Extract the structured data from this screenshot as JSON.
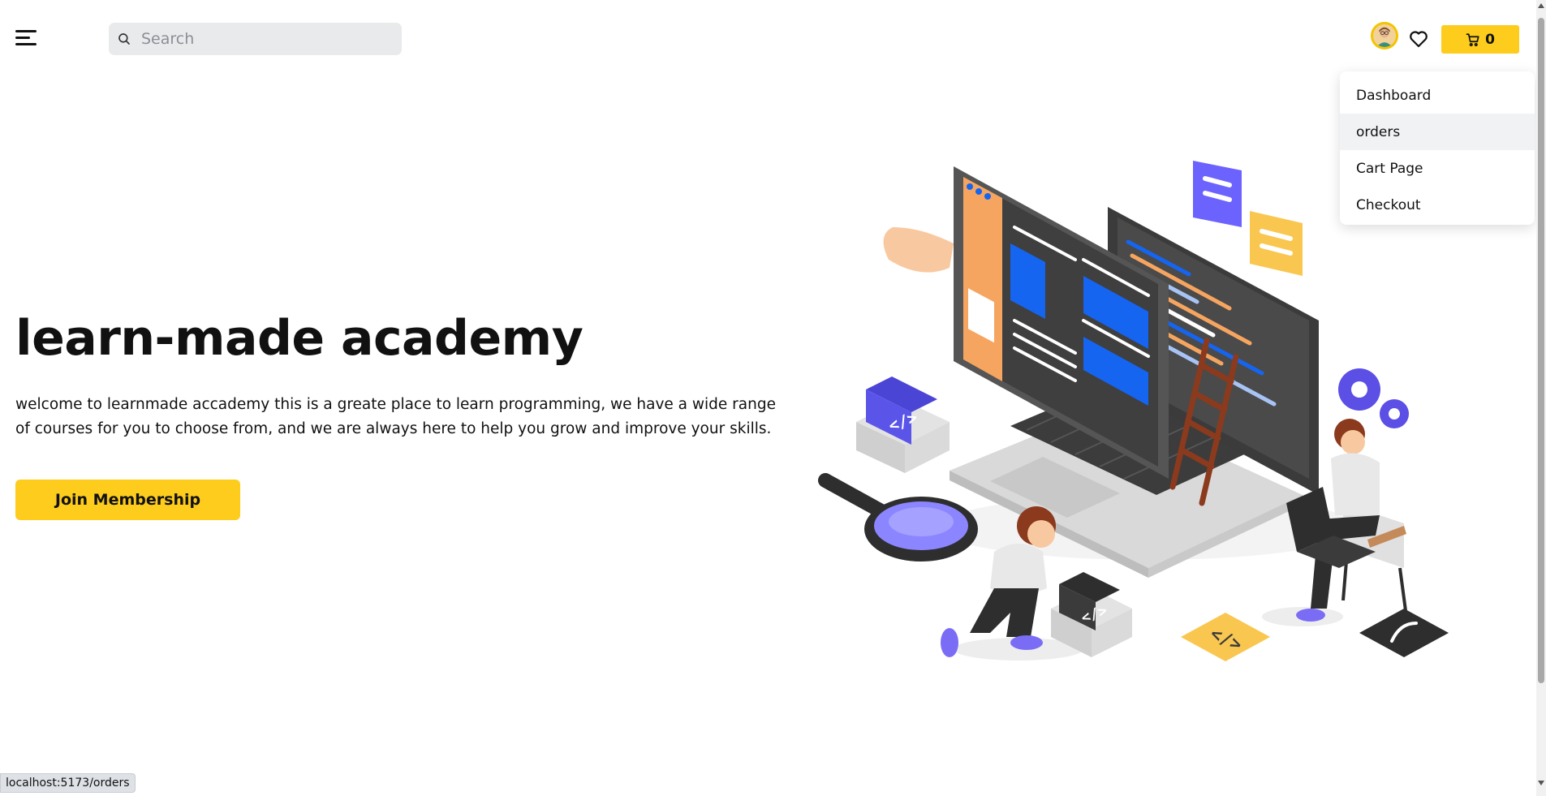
{
  "header": {
    "search_placeholder": "Search",
    "cart_count": "0"
  },
  "dropdown": {
    "items": [
      {
        "label": "Dashboard"
      },
      {
        "label": "orders"
      },
      {
        "label": "Cart Page"
      },
      {
        "label": "Checkout"
      }
    ]
  },
  "hero": {
    "title": "learn-made academy",
    "description": "welcome to learnmade accademy this is a greate place to learn programming, we have a wide range of courses for you to choose from, and we are always here to help you grow and improve your skills.",
    "cta_label": "Join Membership"
  },
  "illustration": {
    "code_label": "</>"
  },
  "status_url": "localhost:5173/orders",
  "colors": {
    "accent": "#fdcc1c",
    "illustration_blue": "#1565f0",
    "illustration_purple": "#6c63ff",
    "illustration_orange": "#f6a560"
  },
  "icons": {
    "menu": "hamburger-menu-icon",
    "search": "search-icon",
    "wishlist": "heart-icon",
    "cart": "shopping-cart-icon"
  }
}
